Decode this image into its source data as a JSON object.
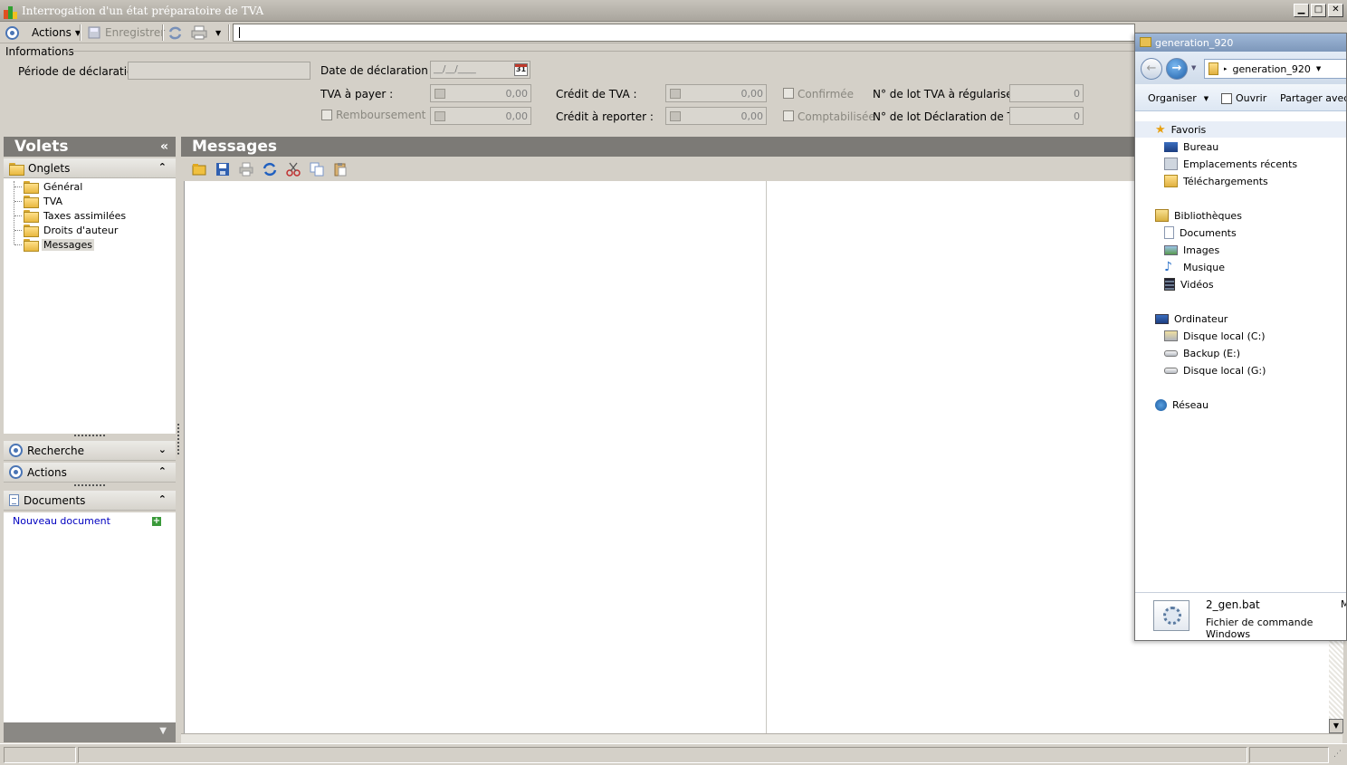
{
  "window": {
    "title": "Interrogation d'un état préparatoire de TVA",
    "min": "▁",
    "max": "□",
    "close": "✕"
  },
  "toolbar": {
    "actions_label": "Actions",
    "save_label": "Enregistrer",
    "search_value": ""
  },
  "info": {
    "section_label": "Informations",
    "periode_label": "Période de déclaration :",
    "periode_value": "",
    "date_label": "Date de déclaration :",
    "date_value": "__/__/____",
    "calendar_day": "31",
    "tva_payer_label": "TVA à payer :",
    "tva_payer_value": "0,00",
    "remboursement_label": "Remboursement",
    "remboursement_value": "0,00",
    "credit_tva_label": "Crédit de TVA :",
    "credit_tva_value": "0,00",
    "credit_reporter_label": "Crédit à reporter :",
    "credit_reporter_value": "0,00",
    "confirmee_label": "Confirmée",
    "comptabilisee_label": "Comptabilisée",
    "lot_regulariser_label": "N° de lot TVA à régulariser :",
    "lot_regulariser_value": "0",
    "lot_declaration_label": "N° de lot Déclaration de TVA :",
    "lot_declaration_value": "0"
  },
  "volets": {
    "title": "Volets",
    "collapse": "«",
    "onglets_label": "Onglets",
    "tree": [
      "Général",
      "TVA",
      "Taxes assimilées",
      "Droits d'auteur",
      "Messages"
    ],
    "recherche_label": "Recherche",
    "actions_label": "Actions",
    "documents_label": "Documents",
    "new_document": "Nouveau document"
  },
  "messages": {
    "title": "Messages"
  },
  "explorer": {
    "title": "generation_920",
    "address": "generation_920",
    "organiser": "Organiser",
    "ouvrir": "Ouvrir",
    "partager": "Partager avec",
    "favoris": "Favoris",
    "favoris_items": [
      "Bureau",
      "Emplacements récents",
      "Téléchargements"
    ],
    "bibliotheques": "Bibliothèques",
    "bibliotheques_items": [
      "Documents",
      "Images",
      "Musique",
      "Vidéos"
    ],
    "ordinateur": "Ordinateur",
    "ordinateur_items": [
      "Disque local (C:)",
      "Backup (E:)",
      "Disque local (G:)"
    ],
    "reseau": "Réseau",
    "file_name": "2_gen.bat",
    "file_type": "Fichier de commande Windows",
    "file_extra": "M"
  },
  "colors": {
    "panel_header": "#7c7a76",
    "window_bg": "#d4d0c8",
    "link": "#0000c0"
  }
}
